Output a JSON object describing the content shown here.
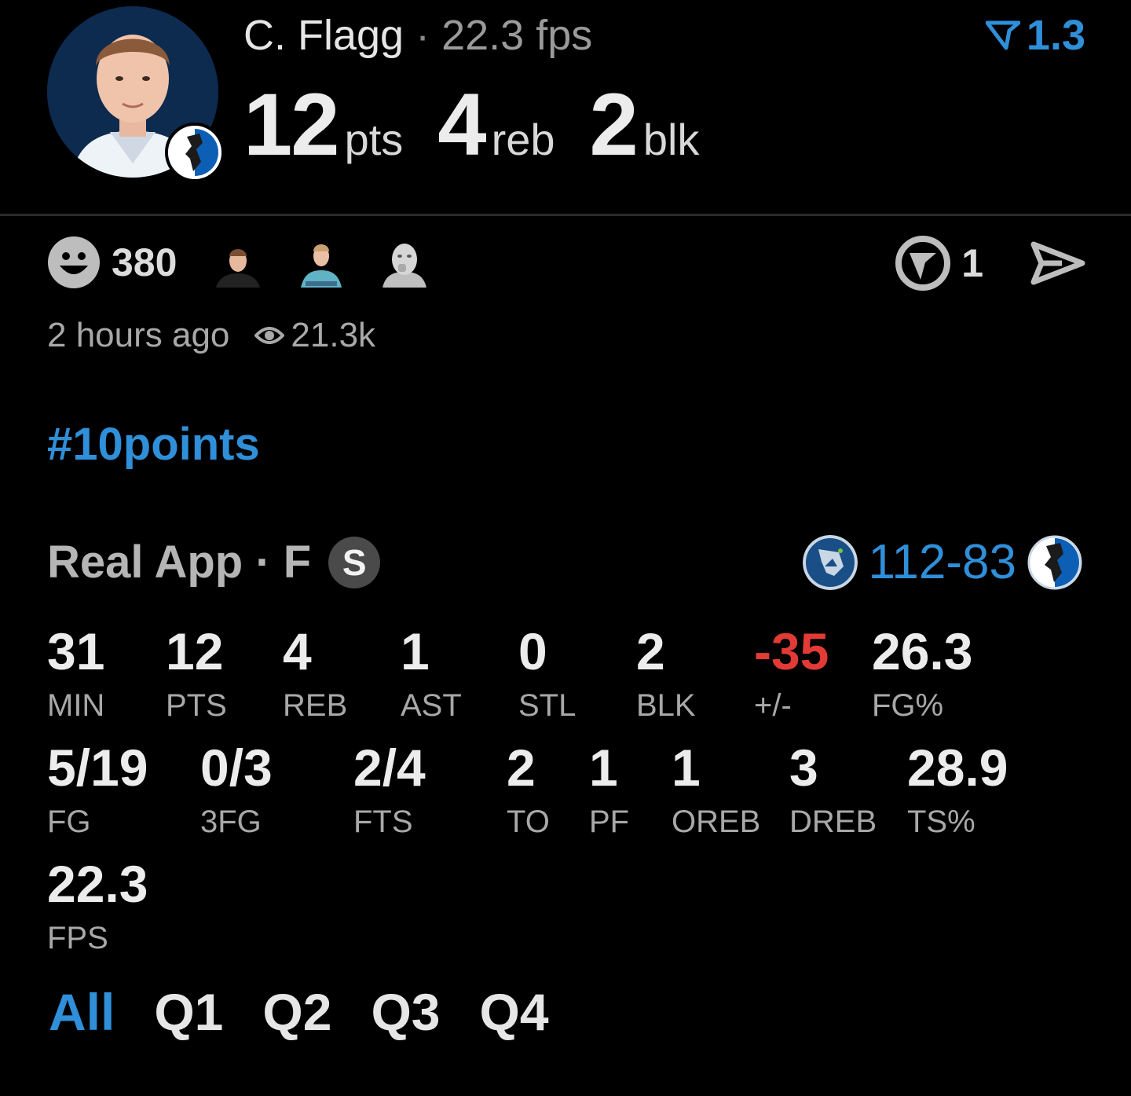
{
  "header": {
    "player_name": "C. Flagg",
    "separator": "·",
    "fps_text": "22.3 fps",
    "rating": "1.3",
    "big_stats": [
      {
        "value": "12",
        "unit": "pts"
      },
      {
        "value": "4",
        "unit": "reb"
      },
      {
        "value": "2",
        "unit": "blk"
      }
    ]
  },
  "reactions": {
    "icon": "smiley-icon",
    "count": "380",
    "avatars": [
      "reactor-avatar-1",
      "reactor-avatar-2",
      "reactor-avatar-3"
    ]
  },
  "actions": {
    "comment_icon": "comment-icon",
    "comment_count": "1",
    "share_icon": "send-icon"
  },
  "meta": {
    "time_ago": "2 hours ago",
    "views": "21.3k"
  },
  "hashtag": "#10points",
  "source": {
    "label": "Real App · F",
    "badge": "S"
  },
  "game": {
    "score": "112-83",
    "home_logo": "timberwolves-logo",
    "away_logo": "mavericks-logo"
  },
  "stats_row1": [
    {
      "value": "31",
      "label": "MIN"
    },
    {
      "value": "12",
      "label": "PTS"
    },
    {
      "value": "4",
      "label": "REB"
    },
    {
      "value": "1",
      "label": "AST"
    },
    {
      "value": "0",
      "label": "STL"
    },
    {
      "value": "2",
      "label": "BLK"
    },
    {
      "value": "-35",
      "label": "+/-"
    },
    {
      "value": "26.3",
      "label": "FG%"
    }
  ],
  "stats_row2": [
    {
      "value": "5/19",
      "label": "FG"
    },
    {
      "value": "0/3",
      "label": "3FG"
    },
    {
      "value": "2/4",
      "label": "FTS"
    },
    {
      "value": "2",
      "label": "TO"
    },
    {
      "value": "1",
      "label": "PF"
    },
    {
      "value": "1",
      "label": "OREB"
    },
    {
      "value": "3",
      "label": "DREB"
    },
    {
      "value": "28.9",
      "label": "TS%"
    }
  ],
  "stats_row3": [
    {
      "value": "22.3",
      "label": "FPS"
    }
  ],
  "quarters": [
    "All",
    "Q1",
    "Q2",
    "Q3",
    "Q4"
  ],
  "colors": {
    "accent": "#2f8fd8",
    "negative": "#e23b36",
    "background": "#000000"
  }
}
